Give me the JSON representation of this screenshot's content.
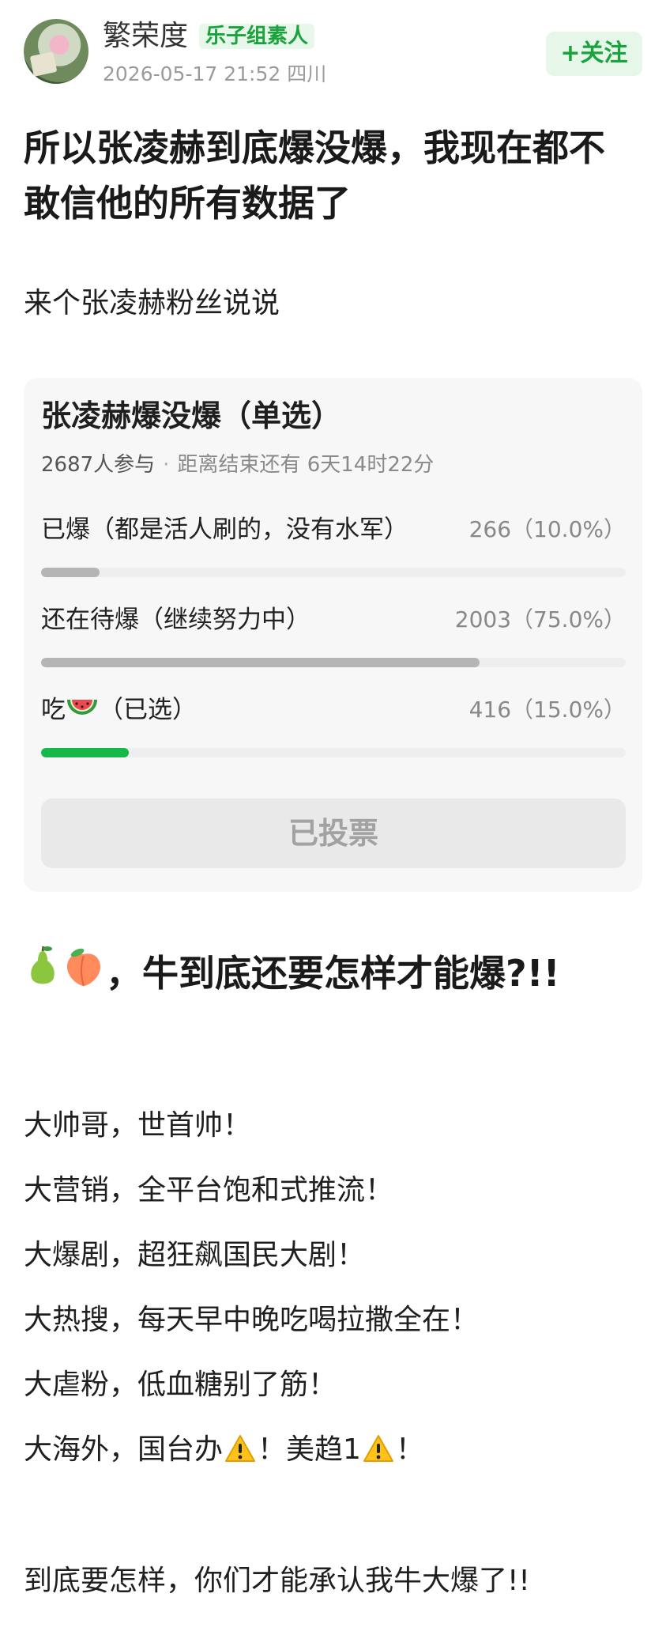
{
  "post": {
    "author": "繁荣度",
    "author_badge": "乐子组素人",
    "timestamp": "2026-05-17 21:52",
    "location": "四川",
    "follow_label": "+关注",
    "title": "所以张凌赫到底爆没爆，我现在都不敢信他的所有数据了",
    "subtitle": "来个张凌赫粉丝说说"
  },
  "poll": {
    "title": "张凌赫爆没爆（单选）",
    "participants": "2687人参与",
    "remaining": "距离结束还有 6天14时22分",
    "options": [
      {
        "label": "已爆（都是活人刷的，没有水军）",
        "count": "266（10.0%）",
        "fraction": 0.1,
        "selected": false
      },
      {
        "label": "还在待爆（继续努力中）",
        "count": "2003（75.0%）",
        "fraction": 0.75,
        "selected": false
      },
      {
        "label": "吃",
        "suffix": "（已选）",
        "count": "416（15.0%）",
        "fraction": 0.15,
        "selected": true,
        "icon": "watermelon-icon"
      }
    ],
    "voted_label": "已投票",
    "colors": {
      "selected_bar": "#16b84a",
      "bar": "#b5b5b5"
    }
  },
  "body": {
    "heading": "，牛到底还要怎样才能爆?!!",
    "heading_icons": [
      "pear-icon",
      "peach-icon"
    ],
    "lines": [
      "大帅哥，世首帅！",
      "大营销，全平台饱和式推流！",
      "大爆剧，超狂飙国民大剧！",
      "大热搜，每天早中晚吃喝拉撒全在！",
      "大虐粉，低血糖别了筋！"
    ],
    "line6_a": "大海外，国台办",
    "line6_b": "！美趋1",
    "line6_c": "！",
    "final": "到底要怎样，你们才能承认我牛大爆了!!"
  },
  "accent": "#1aa33d"
}
